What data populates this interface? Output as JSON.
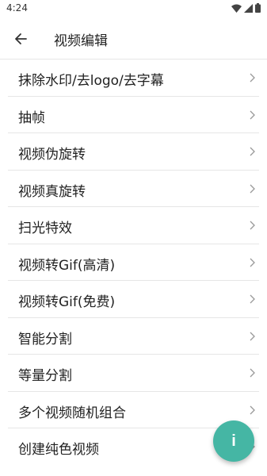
{
  "status_bar": {
    "time": "4:24",
    "icons": [
      "wifi-icon",
      "signal-icon",
      "battery-icon"
    ]
  },
  "app_bar": {
    "title": "视频编辑",
    "back_icon": "arrow-left-icon"
  },
  "menu": {
    "items": [
      {
        "label": "抹除水印/去logo/去字幕"
      },
      {
        "label": "抽帧"
      },
      {
        "label": "视频伪旋转"
      },
      {
        "label": "视频真旋转"
      },
      {
        "label": "扫光特效"
      },
      {
        "label": "视频转Gif(高清)"
      },
      {
        "label": "视频转Gif(免费)"
      },
      {
        "label": "智能分割"
      },
      {
        "label": "等量分割"
      },
      {
        "label": "多个视频随机组合"
      },
      {
        "label": "创建纯色视频"
      }
    ]
  },
  "fab": {
    "label": "i",
    "color": "#45b6a4"
  }
}
